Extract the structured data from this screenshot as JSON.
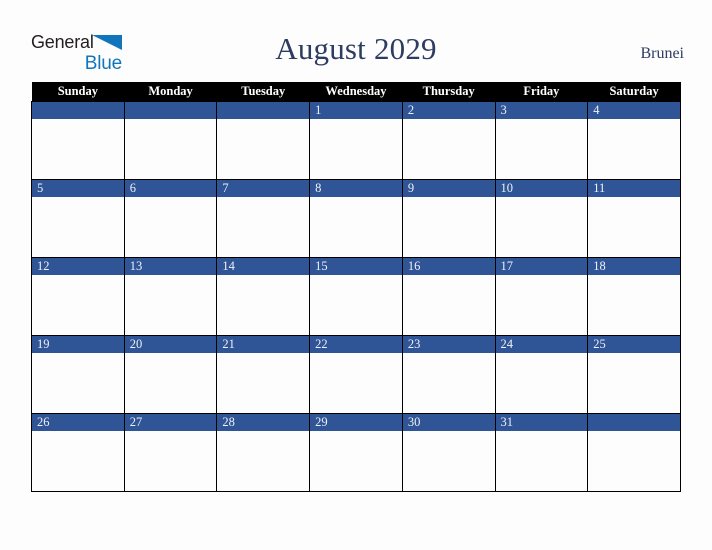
{
  "logo": {
    "text_top": "General",
    "text_bottom": "Blue",
    "triangle_icon": "blue-triangle-icon",
    "color_dark": "#231f20",
    "color_blue": "#1175bb"
  },
  "header": {
    "title": "August 2029",
    "country": "Brunei",
    "title_color": "#2d3c61"
  },
  "calendar": {
    "month": "August",
    "year": "2029",
    "weekday_headers": [
      "Sunday",
      "Monday",
      "Tuesday",
      "Wednesday",
      "Thursday",
      "Friday",
      "Saturday"
    ],
    "header_bg": "#000000",
    "header_text_color": "#ffffff",
    "daybar_bg": "#2f5596",
    "daybar_text_color": "#eef1f7",
    "cell_bg": "#fdfdfd",
    "border_color": "#000000",
    "weeks": [
      {
        "days": [
          {
            "number": ""
          },
          {
            "number": ""
          },
          {
            "number": ""
          },
          {
            "number": "1"
          },
          {
            "number": "2"
          },
          {
            "number": "3"
          },
          {
            "number": "4"
          }
        ]
      },
      {
        "days": [
          {
            "number": "5"
          },
          {
            "number": "6"
          },
          {
            "number": "7"
          },
          {
            "number": "8"
          },
          {
            "number": "9"
          },
          {
            "number": "10"
          },
          {
            "number": "11"
          }
        ]
      },
      {
        "days": [
          {
            "number": "12"
          },
          {
            "number": "13"
          },
          {
            "number": "14"
          },
          {
            "number": "15"
          },
          {
            "number": "16"
          },
          {
            "number": "17"
          },
          {
            "number": "18"
          }
        ]
      },
      {
        "days": [
          {
            "number": "19"
          },
          {
            "number": "20"
          },
          {
            "number": "21"
          },
          {
            "number": "22"
          },
          {
            "number": "23"
          },
          {
            "number": "24"
          },
          {
            "number": "25"
          }
        ]
      },
      {
        "days": [
          {
            "number": "26"
          },
          {
            "number": "27"
          },
          {
            "number": "28"
          },
          {
            "number": "29"
          },
          {
            "number": "30"
          },
          {
            "number": "31"
          },
          {
            "number": ""
          }
        ]
      }
    ]
  }
}
